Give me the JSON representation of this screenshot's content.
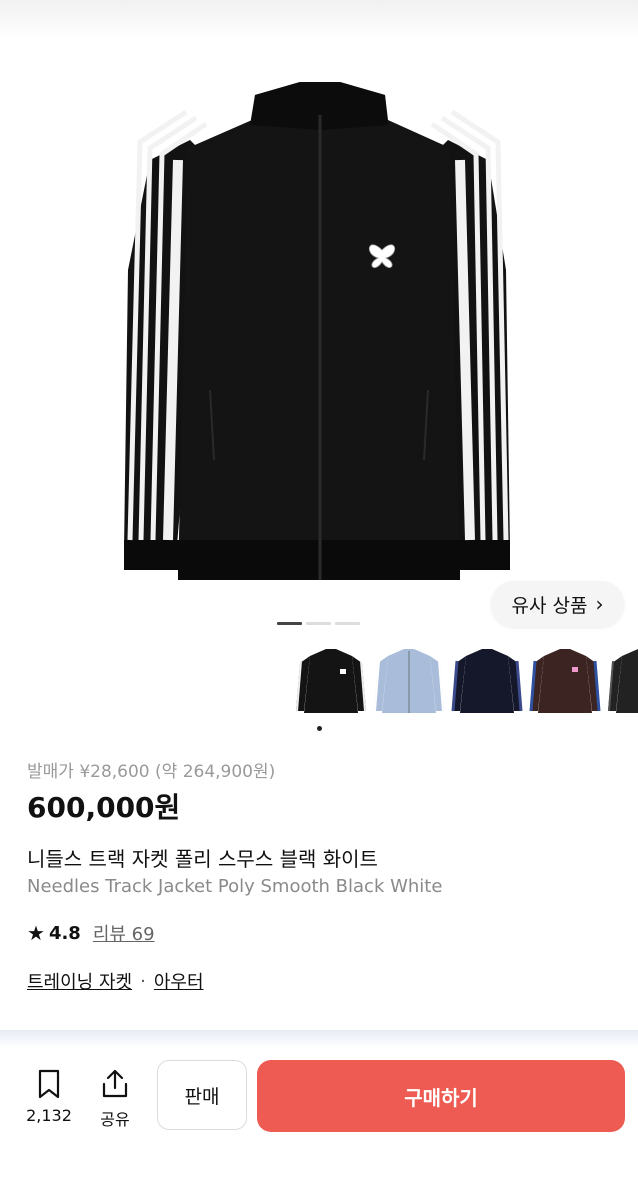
{
  "product": {
    "release_price": "발매가 ¥28,600 (약 264,900원)",
    "price": "600,000원",
    "title_ko": "니들스 트랙 자켓 폴리 스무스 블랙 화이트",
    "title_en": "Needles Track Jacket Poly Smooth Black White",
    "rating": "4.8",
    "reviews_label": "리뷰 69",
    "category_primary": "트레이닝 자켓",
    "category_separator": "·",
    "category_secondary": "아우터"
  },
  "gallery": {
    "similar_label": "유사 상품",
    "page_count": 3,
    "active_page": 1,
    "thumbnails": [
      "black-track-jacket",
      "light-blue-track-jacket",
      "navy-track-jacket",
      "brown-blue-track-jacket",
      "dark-track-jacket"
    ]
  },
  "bottom_bar": {
    "bookmark_count": "2,132",
    "share_label": "공유",
    "sell_label": "판매",
    "buy_label": "구매하기"
  },
  "colors": {
    "buy_button": "#ee5b52",
    "jacket": "#121212",
    "stripe": "#f2f2f2"
  }
}
